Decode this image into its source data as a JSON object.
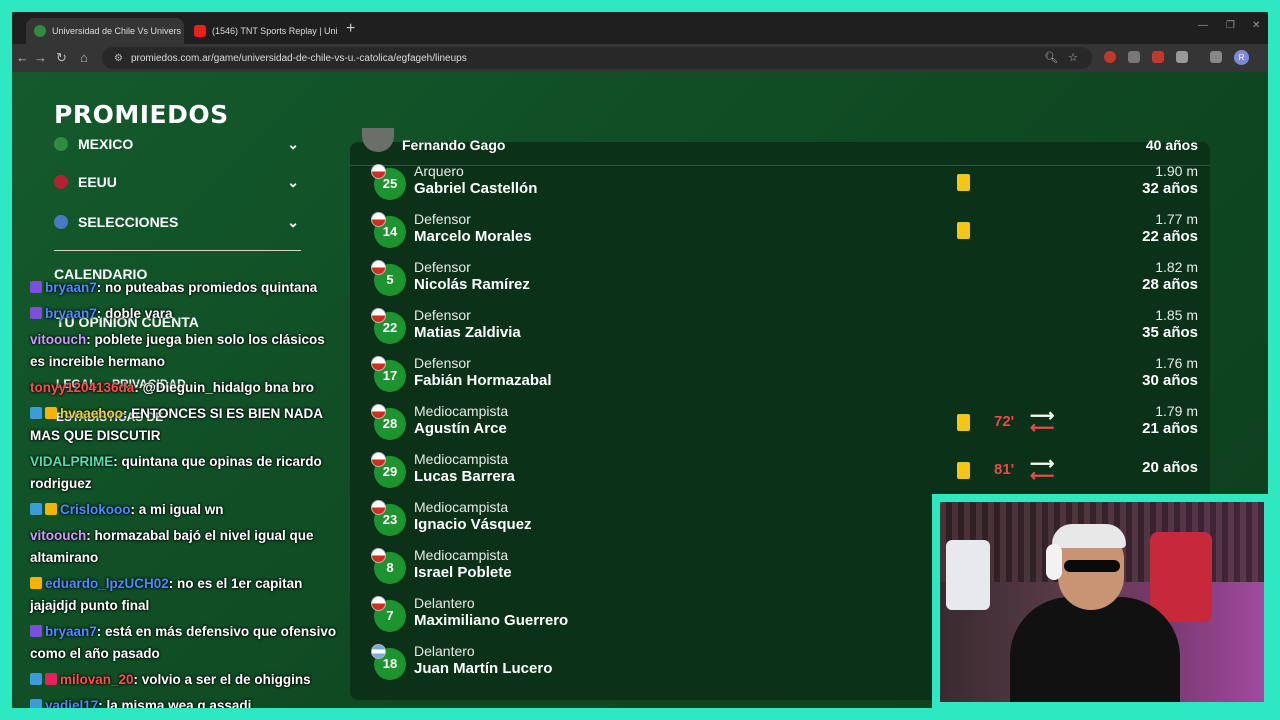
{
  "browser": {
    "tabs": [
      {
        "title": "Universidad de Chile Vs Univers",
        "active": true
      },
      {
        "title": "(1546) TNT Sports Replay | Uni",
        "active": false
      }
    ],
    "new_tab": "+",
    "url": "promiedos.com.ar/game/universidad-de-chile-vs-u.-catolica/egfageh/lineups",
    "profile_initial": "R"
  },
  "site": {
    "logo": "PROMIEDOS",
    "sidebar": {
      "items": [
        {
          "label": "MEXICO",
          "flag_color": "#2e8b3f"
        },
        {
          "label": "EEUU",
          "flag_color": "#b22234"
        },
        {
          "label": "SELECCIONES",
          "flag_color": "#4a78c2"
        }
      ],
      "ghost": [
        "CALENDARIO",
        "TU OPINION CUENTA",
        "LEGAL",
        "PRIVACIDAD",
        "ESTADÍSTICAS DE"
      ]
    }
  },
  "lineup": {
    "coach": {
      "name": "Fernando Gago",
      "age": "40 años"
    },
    "players": [
      {
        "number": "25",
        "position": "Arquero",
        "name": "Gabriel Castellón",
        "height": "1.90 m",
        "age": "32 años",
        "yellow": true,
        "sub_time": "",
        "flag": "chile"
      },
      {
        "number": "14",
        "position": "Defensor",
        "name": "Marcelo Morales",
        "height": "1.77 m",
        "age": "22 años",
        "yellow": true,
        "sub_time": "",
        "flag": "chile"
      },
      {
        "number": "5",
        "position": "Defensor",
        "name": "Nicolás Ramírez",
        "height": "1.82 m",
        "age": "28 años",
        "yellow": false,
        "sub_time": "",
        "flag": "chile"
      },
      {
        "number": "22",
        "position": "Defensor",
        "name": "Matias Zaldivia",
        "height": "1.85 m",
        "age": "35 años",
        "yellow": false,
        "sub_time": "",
        "flag": "chile"
      },
      {
        "number": "17",
        "position": "Defensor",
        "name": "Fabián Hormazabal",
        "height": "1.76 m",
        "age": "30 años",
        "yellow": false,
        "sub_time": "",
        "flag": "chile"
      },
      {
        "number": "28",
        "position": "Mediocampista",
        "name": "Agustín Arce",
        "height": "1.79 m",
        "age": "21 años",
        "yellow": true,
        "sub_time": "72'",
        "flag": "chile"
      },
      {
        "number": "29",
        "position": "Mediocampista",
        "name": "Lucas Barrera",
        "height": "",
        "age": "20 años",
        "yellow": true,
        "sub_time": "81'",
        "flag": "chile"
      },
      {
        "number": "23",
        "position": "Mediocampista",
        "name": "Ignacio Vásquez",
        "height": "",
        "age": "",
        "yellow": false,
        "sub_time": "",
        "flag": "chile"
      },
      {
        "number": "8",
        "position": "Mediocampista",
        "name": "Israel Poblete",
        "height": "",
        "age": "",
        "yellow": false,
        "sub_time": "",
        "flag": "chile"
      },
      {
        "number": "7",
        "position": "Delantero",
        "name": "Maximiliano Guerrero",
        "height": "",
        "age": "",
        "yellow": false,
        "sub_time": "",
        "flag": "chile"
      },
      {
        "number": "18",
        "position": "Delantero",
        "name": "Juan Martín Lucero",
        "height": "",
        "age": "",
        "yellow": false,
        "sub_time": "",
        "flag": "arg"
      }
    ]
  },
  "chat": [
    {
      "user": "bryaan7",
      "color": "#4c8cff",
      "text": ": no puteabas promiedos quintana",
      "badges": [
        "#7b4fd9"
      ]
    },
    {
      "user": "bryaan7",
      "color": "#4c8cff",
      "text": ": doble vara",
      "badges": [
        "#7b4fd9"
      ]
    },
    {
      "user": "vitoouch",
      "color": "#c99bff",
      "text": ": poblete juega bien solo los clásicos es increible hermano",
      "badges": []
    },
    {
      "user": "tonyy1204136da",
      "color": "#ff4d4d",
      "text": ": @Dieguin_hidalgo bna bro",
      "badges": []
    },
    {
      "user": "hvaaehoo",
      "color": "#e6d23a",
      "text": ": ENTONCES SI ES BIEN NADA MAS QUE DISCUTIR",
      "badges": [
        "#3b9bdb",
        "#f5b400"
      ]
    },
    {
      "user": "VIDALPRIME",
      "color": "#4fe0b0",
      "text": ": quintana que opinas de ricardo rodriguez",
      "badges": []
    },
    {
      "user": "Crislokooo",
      "color": "#4c8cff",
      "text": ": a mi igual wn",
      "badges": [
        "#3b9bdb",
        "#f5b400"
      ]
    },
    {
      "user": "vitoouch",
      "color": "#c99bff",
      "text": ": hormazabal bajó el nivel igual que altamirano",
      "badges": []
    },
    {
      "user": "eduardo_lpzUCH02",
      "color": "#4c8cff",
      "text": ": no es el 1er capitan jajajdjd punto final",
      "badges": [
        "#f5b400"
      ]
    },
    {
      "user": "bryaan7",
      "color": "#4c8cff",
      "text": ": está en más defensivo que ofensivo como el año pasado",
      "badges": [
        "#7b4fd9"
      ]
    },
    {
      "user": "milovan_20",
      "color": "#ff4d4d",
      "text": ": volvio a ser el de ohiggins",
      "badges": [
        "#3b9bdb",
        "#e0245e"
      ]
    },
    {
      "user": "yadiel17",
      "color": "#4c8cff",
      "text": ": la misma wea q assadi",
      "badges": [
        "#3b9bdb"
      ]
    }
  ]
}
